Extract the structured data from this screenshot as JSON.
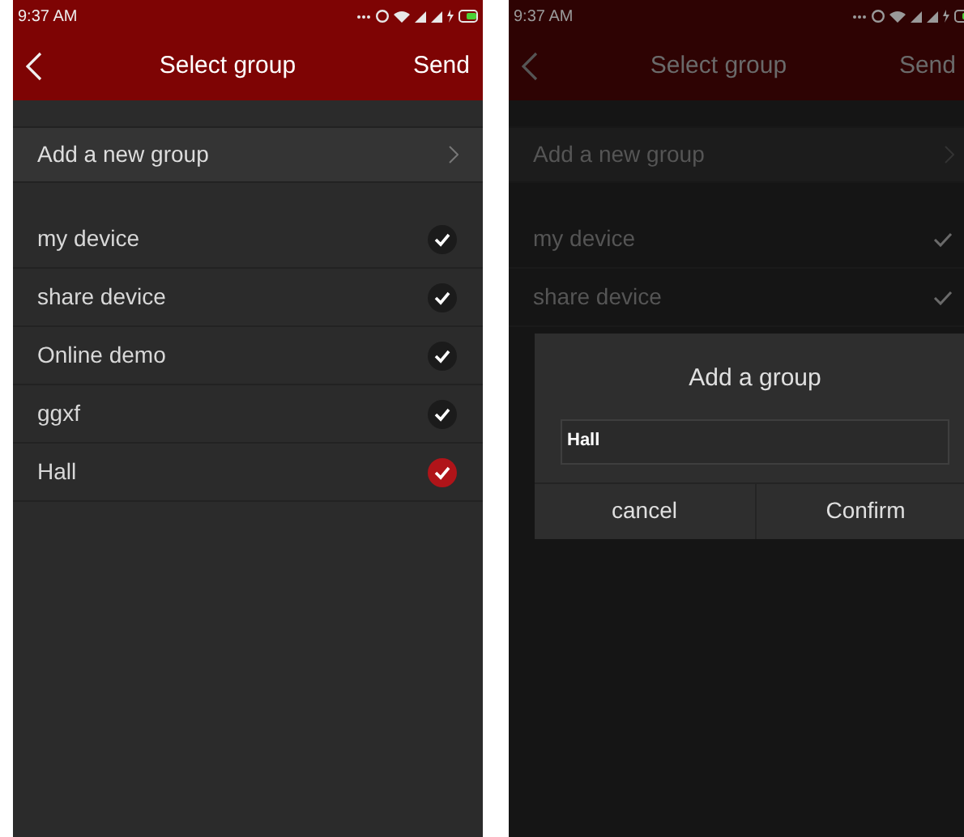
{
  "screens": [
    {
      "dimmed": false,
      "status_time": "9:37 AM",
      "header": {
        "title": "Select group",
        "action": "Send"
      },
      "add_row": "Add a new group",
      "groups": [
        {
          "name": "my device",
          "selected": false
        },
        {
          "name": "share device",
          "selected": false
        },
        {
          "name": "Online demo",
          "selected": false
        },
        {
          "name": "ggxf",
          "selected": false
        },
        {
          "name": "Hall",
          "selected": true
        }
      ]
    },
    {
      "dimmed": true,
      "status_time": "9:37 AM",
      "header": {
        "title": "Select group",
        "action": "Send"
      },
      "add_row": "Add a new group",
      "groups": [
        {
          "name": "my device",
          "selected": false
        },
        {
          "name": "share device",
          "selected": false
        }
      ],
      "dialog": {
        "title": "Add a group",
        "value": "Hall",
        "buttons": [
          "cancel",
          "Confirm"
        ]
      }
    }
  ]
}
